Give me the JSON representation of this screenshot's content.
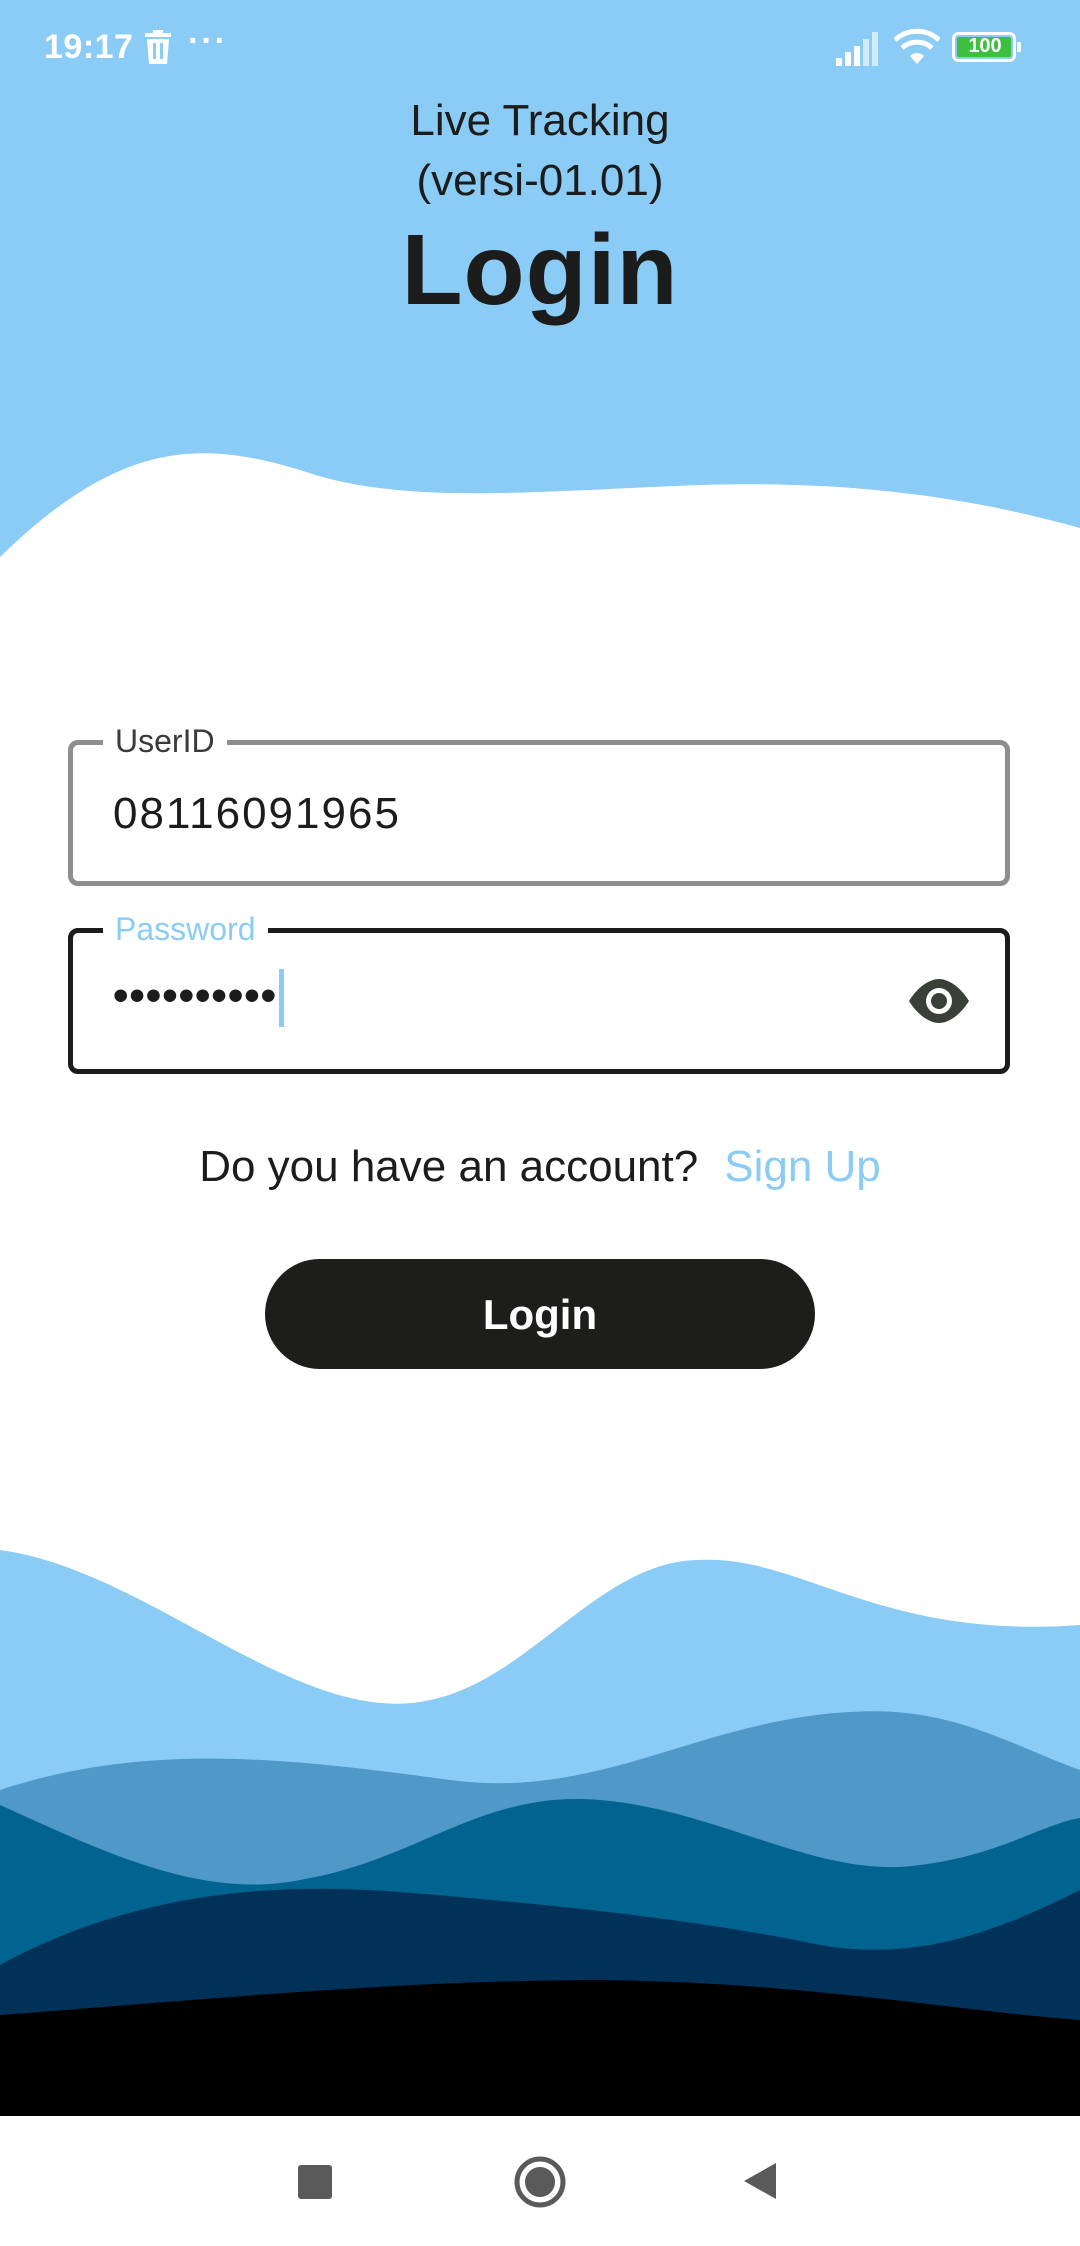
{
  "colors": {
    "accent": "#8ACCF5",
    "button_bg": "#1D1E1C",
    "wave_light": "#8ACCF5",
    "wave_mid": "#5098C7",
    "wave_steel": "#006390",
    "wave_navy": "#003259",
    "wave_black": "#000000"
  },
  "status_bar": {
    "time": "19:17",
    "more_indicator": "···",
    "battery": "100",
    "icons": [
      "trash-icon",
      "signal-icon",
      "wifi-icon",
      "battery-icon"
    ]
  },
  "header": {
    "app_name": "Live Tracking",
    "version": "(versi-01.01)",
    "title": "Login"
  },
  "form": {
    "userid": {
      "label": "UserID",
      "value": "08116091965"
    },
    "password": {
      "label": "Password",
      "masked_value": "••••••••••",
      "toggle_icon": "eye-icon"
    },
    "account_question": "Do you have an account?",
    "signup_label": "Sign Up",
    "login_label": "Login"
  },
  "nav_bar": {
    "icons": [
      "recent-apps-icon",
      "home-icon",
      "back-icon"
    ]
  }
}
